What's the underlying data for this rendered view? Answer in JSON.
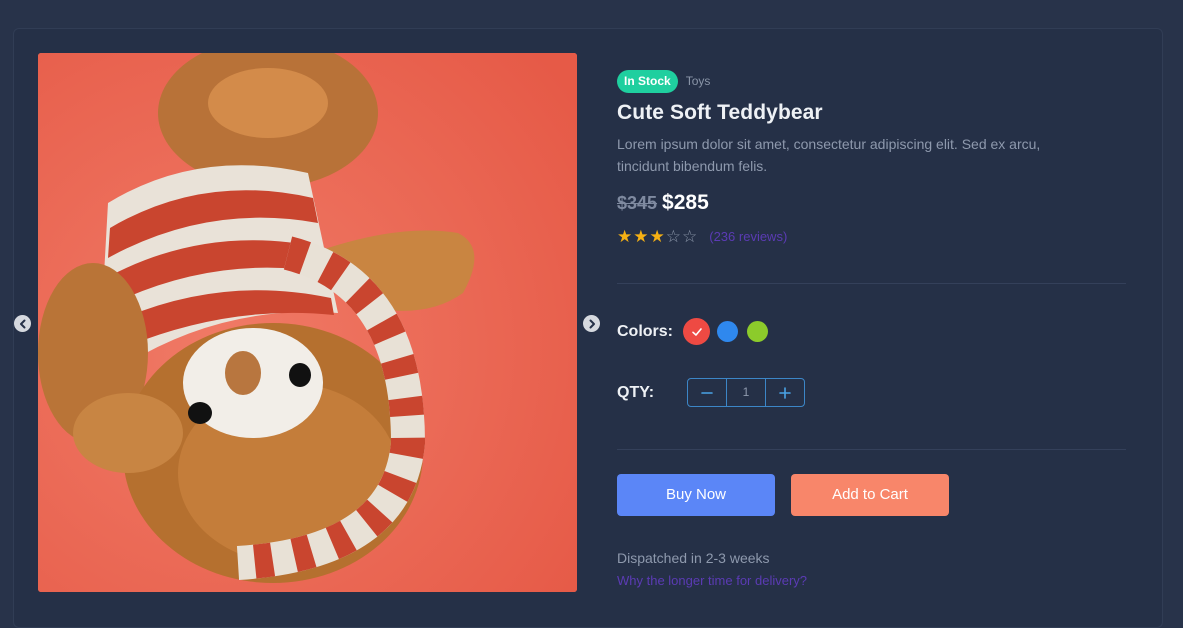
{
  "product": {
    "stock_badge": "In Stock",
    "category": "Toys",
    "title": "Cute Soft Teddybear",
    "description": "Lorem ipsum dolor sit amet, consectetur adipiscing elit. Sed ex arcu, tincidunt bibendum felis.",
    "old_price": "$345",
    "new_price": "$285",
    "rating": 3,
    "rating_max": 5,
    "reviews": "(236 reviews)",
    "image_icon": "teddybear-photo"
  },
  "gallery": {
    "prev_icon": "chevron-left-icon",
    "next_icon": "chevron-right-icon"
  },
  "options": {
    "colors_label": "Colors:",
    "colors": [
      {
        "hex": "#ee4a43",
        "selected": true
      },
      {
        "hex": "#2f88ee",
        "selected": false
      },
      {
        "hex": "#8ccb2b",
        "selected": false
      }
    ],
    "qty_label": "QTY:",
    "qty_value": "1"
  },
  "actions": {
    "buy_now": "Buy Now",
    "add_to_cart": "Add to Cart"
  },
  "shipping": {
    "dispatch_text": "Dispatched in 2-3 weeks",
    "delivery_link": "Why the longer time for delivery?"
  },
  "theme": {
    "badge_color": "#1fcf9f",
    "buy_color": "#5b86f7",
    "cart_color": "#f8866a",
    "star_color": "#f5b014"
  }
}
